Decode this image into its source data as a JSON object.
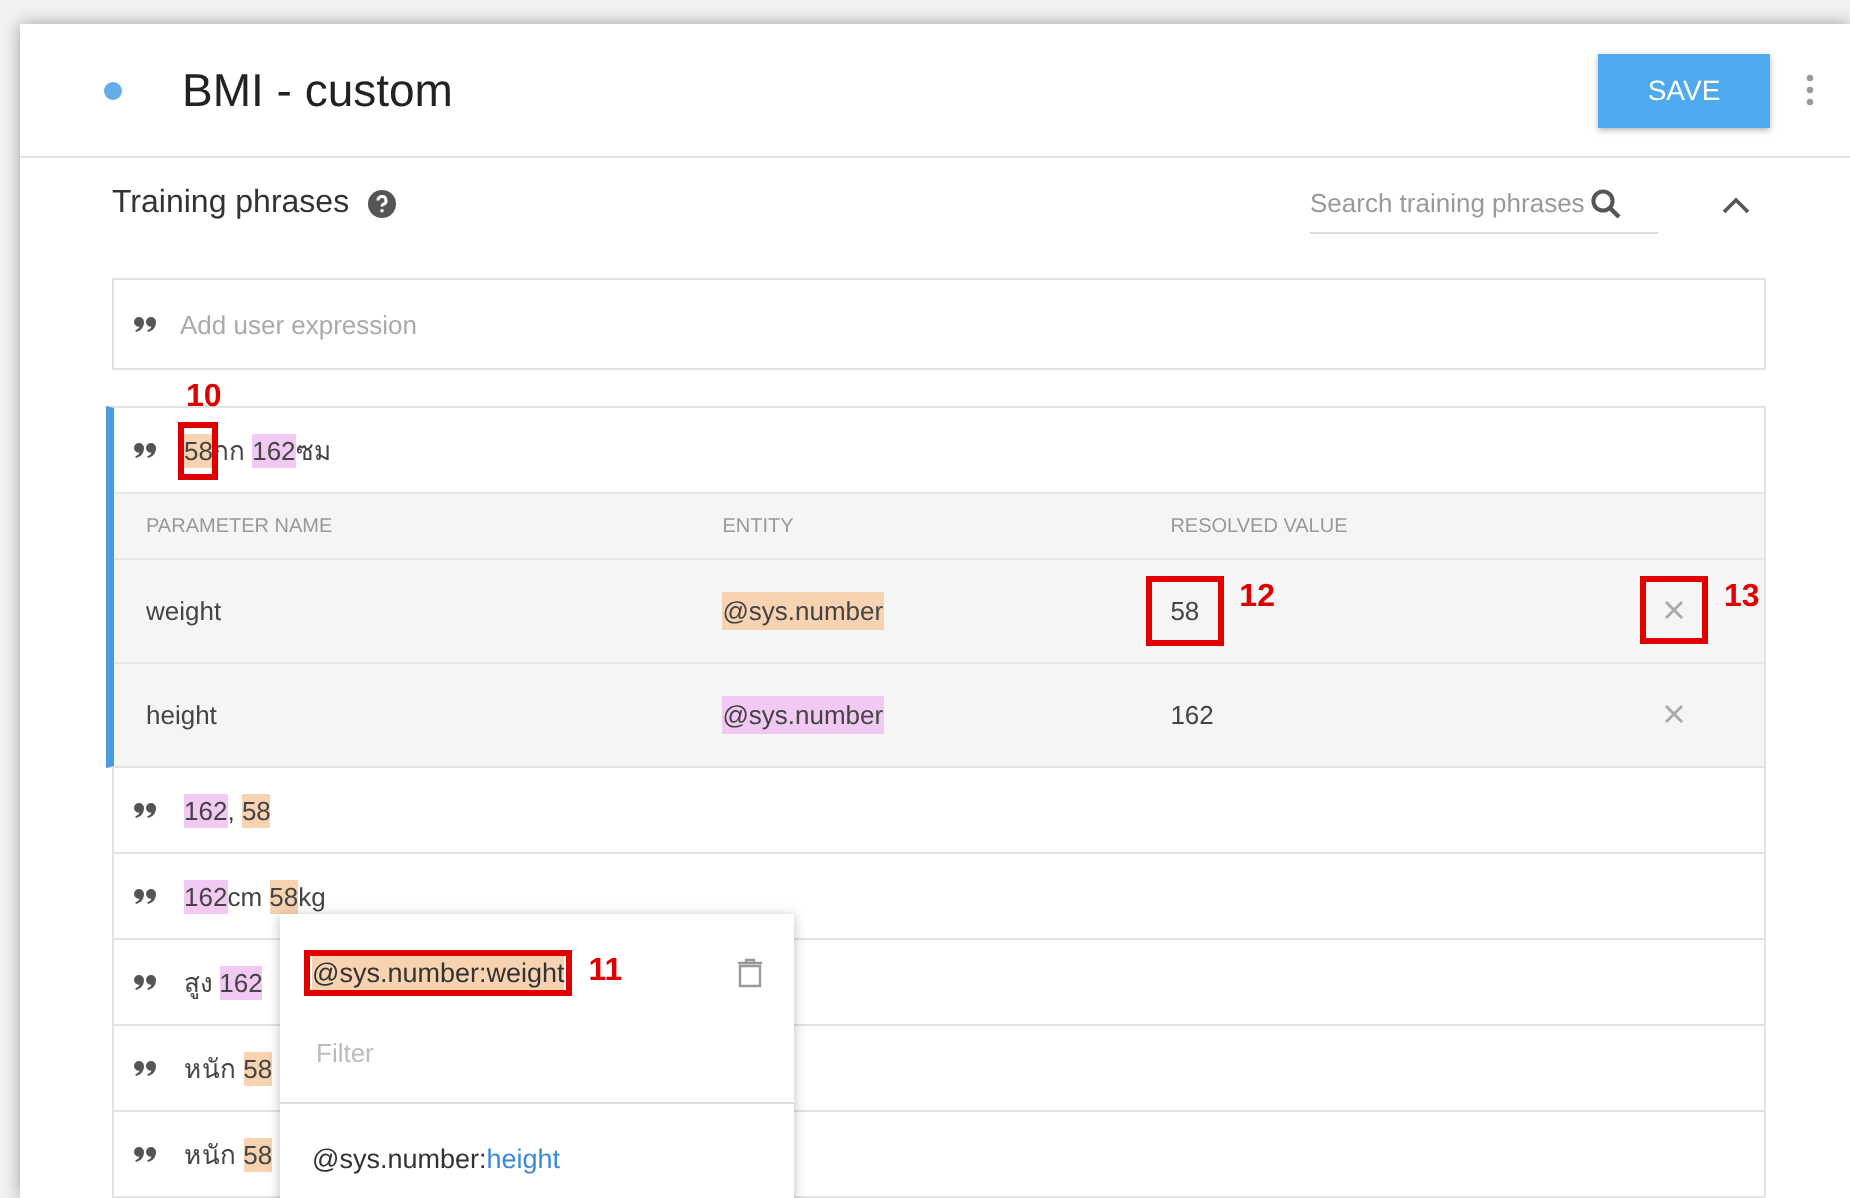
{
  "header": {
    "title": "BMI - custom",
    "save_label": "SAVE"
  },
  "section": {
    "title": "Training phrases",
    "search_placeholder": "Search training phrases",
    "expanded": true
  },
  "add_placeholder": "Add user expression",
  "phrases": [
    {
      "expanded": true,
      "segments": [
        {
          "text": "58",
          "color": "#f8d3b2",
          "callout": "10"
        },
        {
          "text": "กก "
        },
        {
          "text": "162",
          "color": "#f2c9f2"
        },
        {
          "text": "ซม"
        }
      ],
      "parameters": {
        "columns": [
          "PARAMETER NAME",
          "ENTITY",
          "RESOLVED VALUE"
        ],
        "rows": [
          {
            "name": "weight",
            "entity": "@sys.number",
            "color": "#f8d3b2",
            "value": "58",
            "value_callout": "12",
            "remove_callout": "13"
          },
          {
            "name": "height",
            "entity": "@sys.number",
            "color": "#f2c9f2",
            "value": "162"
          }
        ]
      }
    },
    {
      "expanded": false,
      "segments": [
        {
          "text": "162",
          "color": "#f2c9f2"
        },
        {
          "text": ", "
        },
        {
          "text": "58",
          "color": "#f8d3b2"
        }
      ]
    },
    {
      "expanded": false,
      "segments": [
        {
          "text": "162",
          "color": "#f2c9f2"
        },
        {
          "text": "cm "
        },
        {
          "text": "58",
          "color": "#f8d3b2"
        },
        {
          "text": "kg"
        }
      ]
    },
    {
      "expanded": false,
      "segments": [
        {
          "text": "สูง "
        },
        {
          "text": "162",
          "color": "#f2c9f2"
        }
      ]
    },
    {
      "expanded": false,
      "segments": [
        {
          "text": "หนัก "
        },
        {
          "text": "58",
          "color": "#f8d3b2"
        }
      ]
    },
    {
      "expanded": false,
      "segments": [
        {
          "text": "หนัก "
        },
        {
          "text": "58",
          "color": "#f8d3b2"
        }
      ]
    }
  ],
  "popup": {
    "current": "@sys.number:weight",
    "color": "#f8d3b2",
    "callout": "11",
    "filter_placeholder": "Filter",
    "options": [
      {
        "prefix": "@sys.number:",
        "name": "height"
      }
    ]
  }
}
